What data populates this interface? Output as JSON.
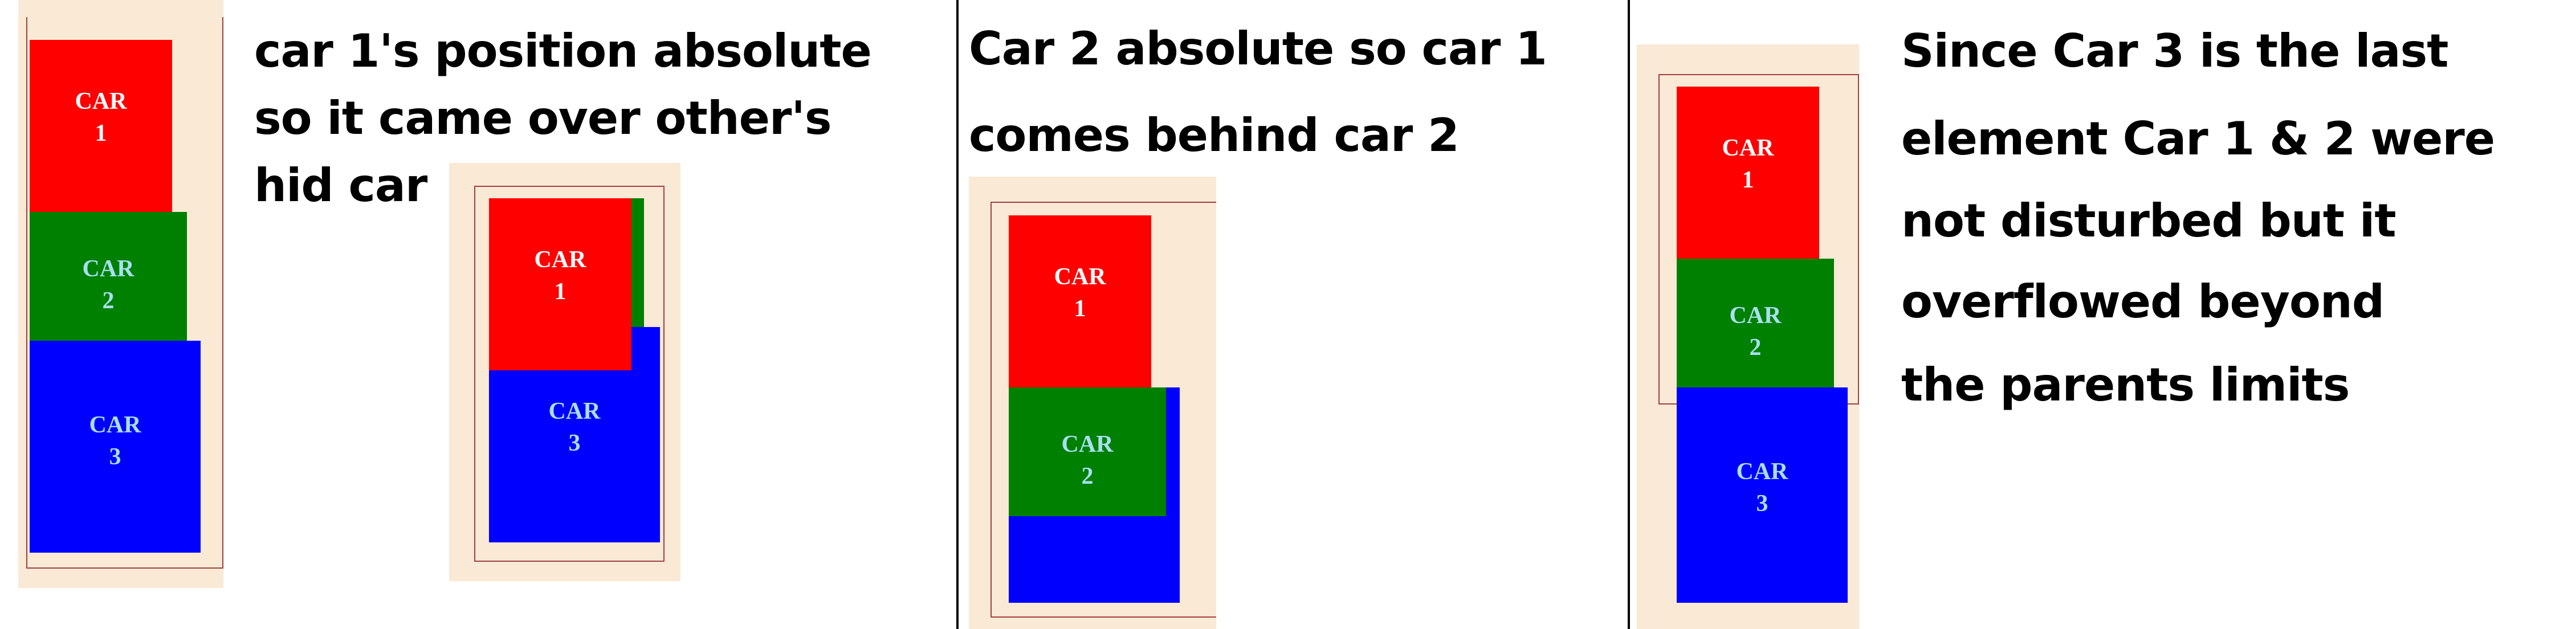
{
  "colors": {
    "car1": "#ff0000",
    "car2": "#008000",
    "car3": "#0000ff",
    "parent_bg": "#f9e9d5",
    "parent_border": "#a04040"
  },
  "car_labels": {
    "car1": "CAR\n1",
    "car2": "CAR\n2",
    "car3": "CAR\n3"
  },
  "captions": {
    "panel1": [
      "car 1's position absolute",
      "so it came over other's",
      "hid car"
    ],
    "panel2": [
      "Car 2 absolute so car 1",
      "comes behind car 2"
    ],
    "panel3": [
      "Since Car 3 is the last",
      "element Car 1 & 2 were",
      "not disturbed but it",
      "overflowed beyond",
      "the parents limits"
    ]
  }
}
